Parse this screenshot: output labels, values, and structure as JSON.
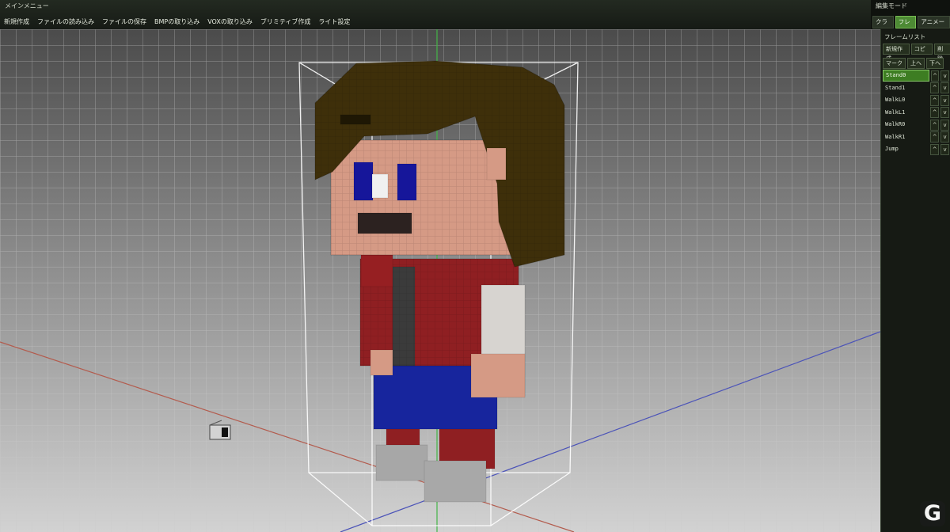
{
  "main_menu": {
    "title": "メインメニュー",
    "items": [
      "新規作成",
      "ファイルの読み込み",
      "ファイルの保存",
      "BMPの取り込み",
      "VOXの取り込み",
      "ブリミティブ作成",
      "ライト設定"
    ]
  },
  "edit_mode": {
    "title": "編集モード",
    "tabs": [
      {
        "label": "クラスタ",
        "active": false
      },
      {
        "label": "フレーム",
        "active": true
      },
      {
        "label": "アニメーション",
        "active": false
      }
    ]
  },
  "frame_list": {
    "title": "フレームリスト",
    "buttons_row1": [
      "新規作成",
      "コピー",
      "削除"
    ],
    "buttons_row2": [
      "マーク",
      "上へ",
      "下へ"
    ],
    "frames": [
      {
        "name": "Stand0",
        "selected": true
      },
      {
        "name": "Stand1",
        "selected": false
      },
      {
        "name": "WalkL0",
        "selected": false
      },
      {
        "name": "WalkL1",
        "selected": false
      },
      {
        "name": "WalkR0",
        "selected": false
      },
      {
        "name": "WalkR1",
        "selected": false
      },
      {
        "name": "Jump",
        "selected": false
      }
    ],
    "move_up_symbol": "^",
    "move_down_symbol": "v"
  },
  "colors": {
    "accent_green": "#4d8a34",
    "hair": "#3e2f0a",
    "skin": "#d59a85",
    "jacket": "#8f1f22",
    "pants": "#17259d",
    "shirt": "#5d5d5d"
  },
  "watermark": "G"
}
